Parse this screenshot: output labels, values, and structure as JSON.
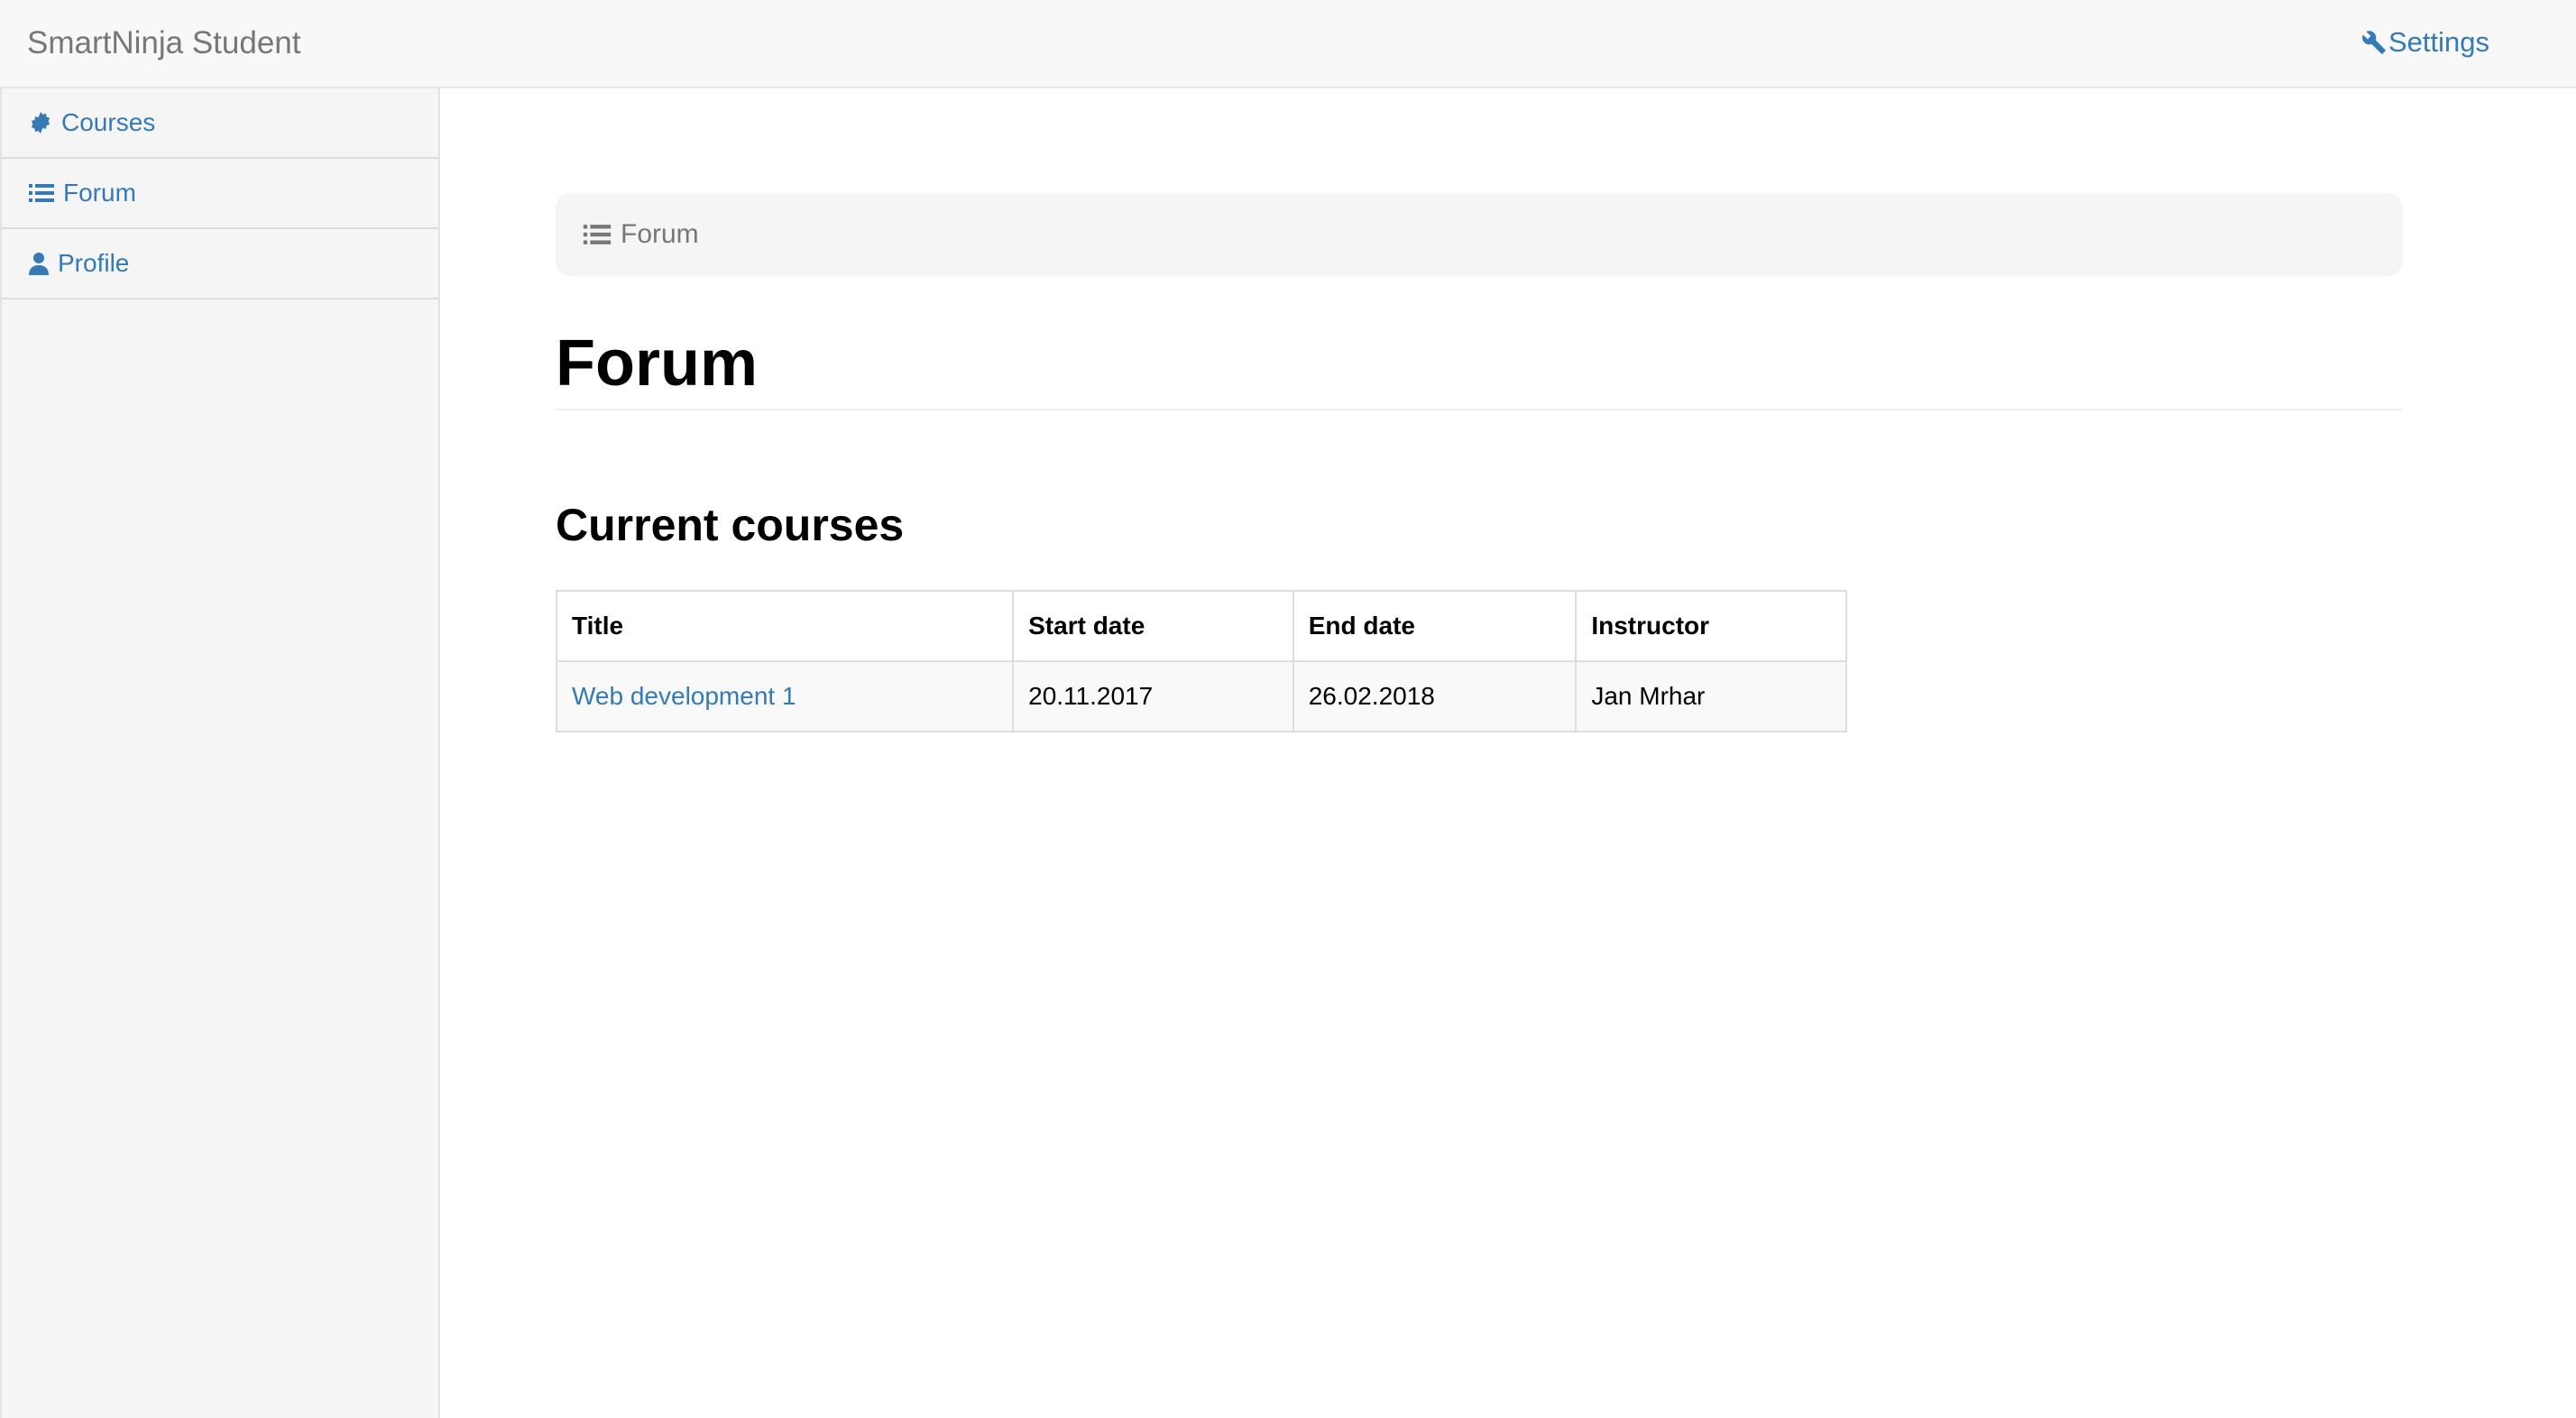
{
  "navbar": {
    "brand": "SmartNinja Student",
    "settings_label": "Settings",
    "settings_icon": "wrench-icon"
  },
  "sidebar": {
    "items": [
      {
        "label": "Courses",
        "icon": "certificate-icon"
      },
      {
        "label": "Forum",
        "icon": "list-icon"
      },
      {
        "label": "Profile",
        "icon": "user-icon"
      }
    ]
  },
  "breadcrumb": {
    "label": "Forum",
    "icon": "list-icon"
  },
  "main": {
    "page_title": "Forum",
    "section_title": "Current courses",
    "table": {
      "headers": [
        "Title",
        "Start date",
        "End date",
        "Instructor"
      ],
      "rows": [
        [
          "Web development 1",
          "20.11.2017",
          "26.02.2018",
          "Jan Mrhar"
        ]
      ]
    }
  },
  "colors": {
    "link": "#337ab7",
    "navbar_bg": "#f8f8f8",
    "sidebar_bg": "#f5f5f5",
    "muted_text": "#777777"
  }
}
